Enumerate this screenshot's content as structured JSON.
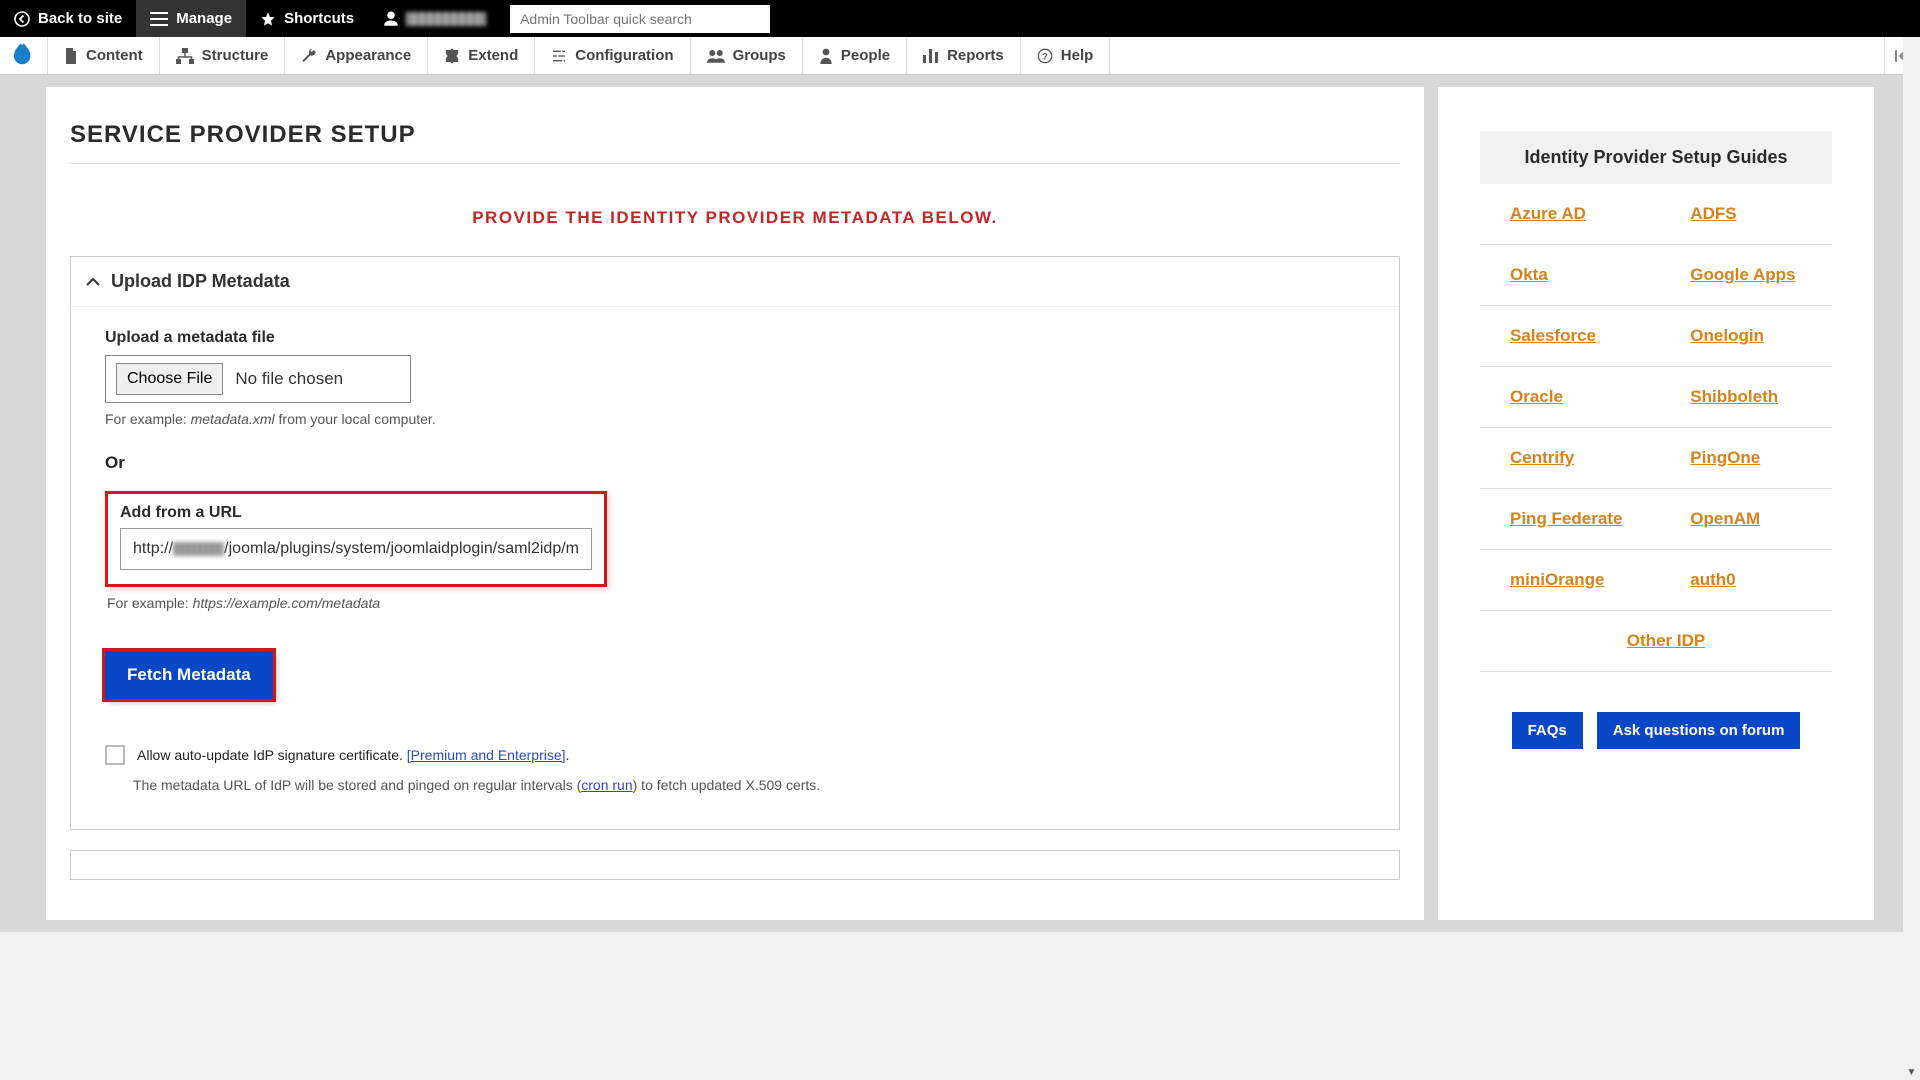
{
  "toolbar": {
    "back": "Back to site",
    "manage": "Manage",
    "shortcuts": "Shortcuts",
    "search_placeholder": "Admin Toolbar quick search"
  },
  "menu": {
    "content": "Content",
    "structure": "Structure",
    "appearance": "Appearance",
    "extend": "Extend",
    "configuration": "Configuration",
    "groups": "Groups",
    "people": "People",
    "reports": "Reports",
    "help": "Help"
  },
  "page": {
    "title": "SERVICE PROVIDER SETUP",
    "subtitle": "PROVIDE THE IDENTITY PROVIDER METADATA BELOW."
  },
  "accordion1": {
    "title": "Upload IDP Metadata",
    "file_label": "Upload a metadata file",
    "choose_button": "Choose File",
    "no_file": "No file chosen",
    "file_helper_pre": "For example: ",
    "file_helper_em": "metadata.xml",
    "file_helper_post": " from your local computer.",
    "or": "Or",
    "url_label": "Add from a URL",
    "url_prefix": "http://",
    "url_suffix": "/joomla/plugins/system/joomlaidplogin/saml2idp/m",
    "url_helper_pre": "For example: ",
    "url_helper_em": "https://example.com/metadata",
    "fetch_button": "Fetch Metadata",
    "auto_update_text": "Allow auto-update IdP signature certificate. ",
    "premium_link": "[Premium and Enterprise]",
    "period": ".",
    "note_pre": "The metadata URL of IdP will be stored and pinged on regular intervals (",
    "note_link": "cron run",
    "note_post": ") to fetch updated X.509 certs."
  },
  "side": {
    "title": "Identity Provider Setup Guides",
    "guides": [
      [
        "Azure AD",
        "ADFS"
      ],
      [
        "Okta",
        "Google Apps"
      ],
      [
        "Salesforce",
        "Onelogin"
      ],
      [
        "Oracle",
        "Shibboleth"
      ],
      [
        "Centrify",
        "PingOne"
      ],
      [
        "Ping Federate",
        "OpenAM"
      ],
      [
        "miniOrange",
        "auth0"
      ]
    ],
    "other": "Other IDP",
    "faqs": "FAQs",
    "forum": "Ask questions on forum"
  }
}
